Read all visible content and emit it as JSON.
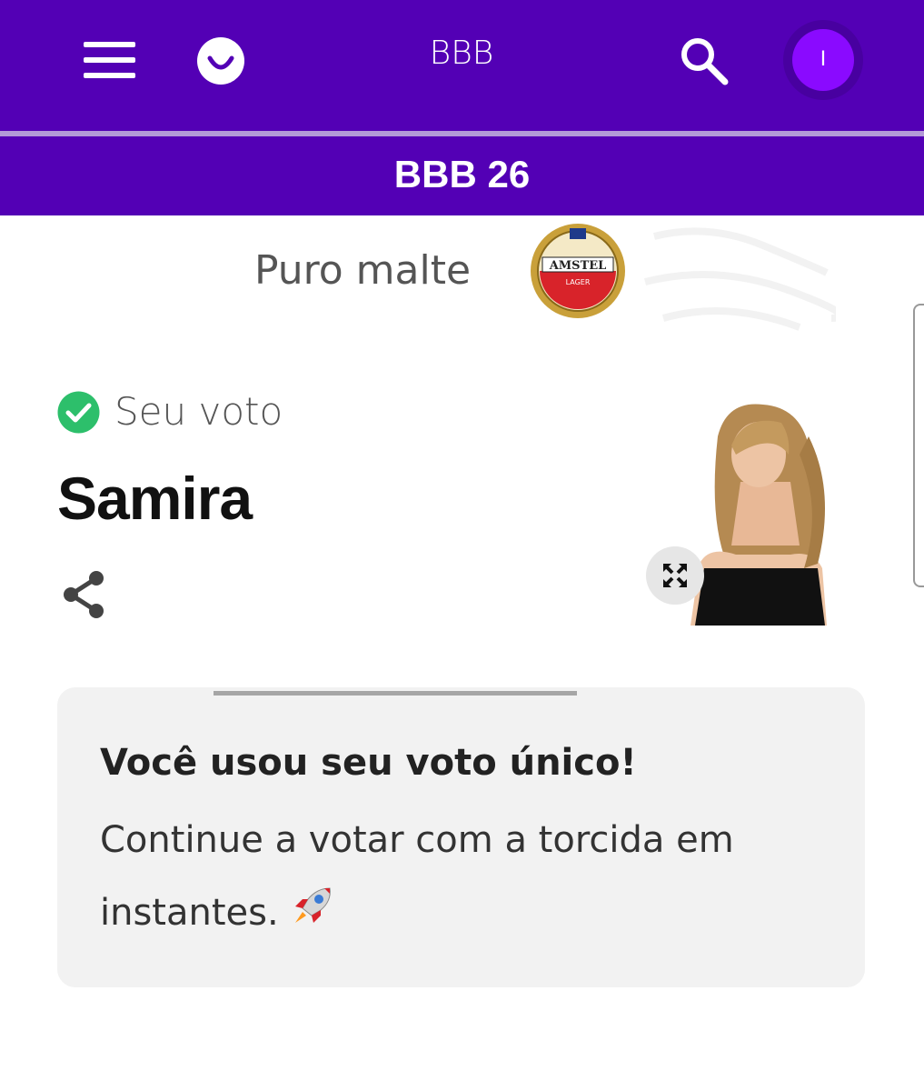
{
  "header": {
    "title": "BBB",
    "avatar_initial": "I"
  },
  "subheader": {
    "title": "BBB 26"
  },
  "sponsor": {
    "tagline": "Puro malte",
    "badge_brand": "AMSTEL",
    "badge_sub": "LAGER"
  },
  "vote": {
    "label": "Seu voto",
    "candidate_name": "Samira"
  },
  "notice": {
    "title": "Você usou seu voto único!",
    "body": "Continue a votar com a torcida em instantes."
  },
  "colors": {
    "brand_purple": "#5300b5",
    "avatar_purple": "#8a0aff",
    "check_green": "#2dbf6b",
    "card_bg": "#f2f2f2"
  },
  "icons": [
    "menu-icon",
    "logo-icon",
    "search-icon",
    "check-circle-icon",
    "share-icon",
    "expand-icon",
    "rocket-icon"
  ]
}
